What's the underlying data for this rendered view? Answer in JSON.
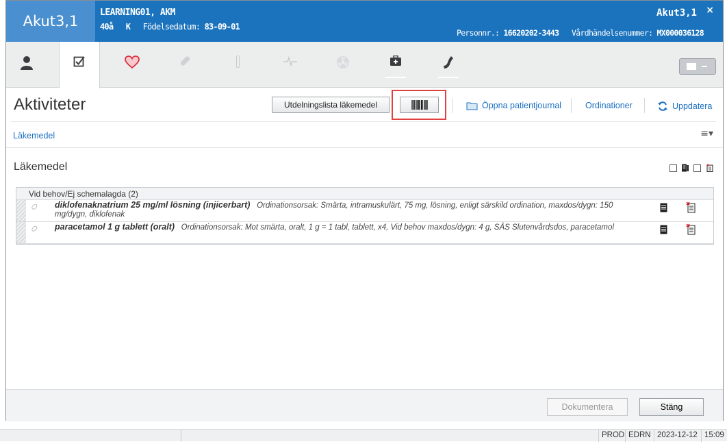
{
  "titlebar": {
    "unit": "Akut3,1",
    "patient_name": "LEARNING01, AKM",
    "age": "40å",
    "sex": "K",
    "dob_label": "Födelsedatum:",
    "dob": "83-09-01",
    "right_unit": "Akut3,1",
    "close": "×",
    "personnr_label": "Personnr.:",
    "personnr": "16620202-3443",
    "vardhandelse_label": "Vårdhändelsenummer:",
    "vardhandelse": "MX000036128"
  },
  "header": {
    "title": "Aktiviteter",
    "utdelning_button": "Utdelningslista läkemedel",
    "barcode_button": "barcode-icon",
    "open_journal": "Öppna patientjournal",
    "ordinationer": "Ordinationer",
    "uppdatera": "Uppdatera"
  },
  "subnav": {
    "filter_link": "Läkemedel",
    "menu": "≡▾"
  },
  "section": {
    "title": "Läkemedel"
  },
  "list": {
    "group_label": "Vid behov/Ej schemalagda (2)",
    "rows": [
      {
        "name": "diklofenaknatrium 25 mg/ml lösning (injicerbart)",
        "details": "Ordinationsorsak: Smärta, intramuskulärt, 75 mg, lösning, enligt särskild ordination, maxdos/dygn: 150 mg/dygn, diklofenak"
      },
      {
        "name": "paracetamol 1 g tablett (oralt)",
        "details": "Ordinationsorsak: Mot smärta, oralt, 1 g = 1 tabl, tablett, x4, Vid behov maxdos/dygn: 4 g, SÄS Slutenvårdsdos, paracetamol"
      }
    ]
  },
  "footer": {
    "dokumentera": "Dokumentera",
    "stang": "Stäng"
  },
  "statusbar": {
    "env": "PROD",
    "code": "EDRN",
    "date": "2023-12-12",
    "time": "15:09"
  },
  "colors": {
    "titlebar": "#1b73bd",
    "unit_box": "#4a8fcf",
    "link": "#1b6fc2",
    "highlight": "#e0413e"
  }
}
